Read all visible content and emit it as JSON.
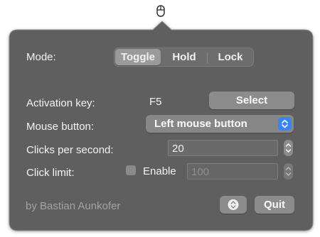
{
  "menubar": {
    "icon": "mouse-icon"
  },
  "mode": {
    "label": "Mode:",
    "options": [
      "Toggle",
      "Hold",
      "Lock"
    ],
    "selected": "Toggle"
  },
  "activation": {
    "label": "Activation key:",
    "value": "F5",
    "button": "Select"
  },
  "mouse_button": {
    "label": "Mouse button:",
    "value": "Left mouse button"
  },
  "cps": {
    "label": "Clicks per second:",
    "value": "20"
  },
  "click_limit": {
    "label": "Click limit:",
    "checkbox_label": "Enable",
    "checked": false,
    "value": "100"
  },
  "footer": {
    "credit": "by Bastian Aunkofer",
    "info_icon": "chevron-circle-icon",
    "quit": "Quit"
  },
  "colors": {
    "panel": "#5f5f5f",
    "accent": "#3b82f6"
  }
}
